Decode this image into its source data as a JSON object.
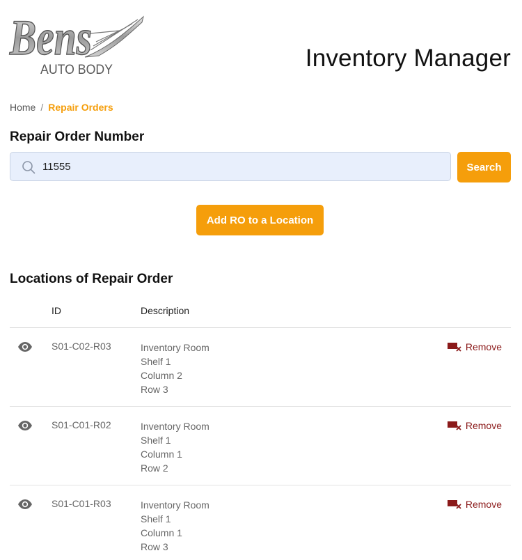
{
  "logo": {
    "brand": "Bens",
    "tagline": "AUTO BODY"
  },
  "header": {
    "title": "Inventory Manager"
  },
  "breadcrumb": {
    "home": "Home",
    "separator": "/",
    "current": "Repair Orders"
  },
  "repair_order": {
    "heading": "Repair Order Number",
    "search": {
      "value": "11555",
      "placeholder": ""
    },
    "search_button": "Search",
    "add_button": "Add RO to a Location"
  },
  "locations": {
    "heading": "Locations of Repair Order",
    "columns": {
      "id": "ID",
      "description": "Description"
    },
    "rows": [
      {
        "id": "S01-C02-R03",
        "description": [
          "Inventory Room",
          "Shelf 1",
          "Column 2",
          "Row 3"
        ],
        "action": "Remove"
      },
      {
        "id": "S01-C01-R02",
        "description": [
          "Inventory Room",
          "Shelf 1",
          "Column 1",
          "Row 2"
        ],
        "action": "Remove"
      },
      {
        "id": "S01-C01-R03",
        "description": [
          "Inventory Room",
          "Shelf 1",
          "Column 1",
          "Row 3"
        ],
        "action": "Remove"
      }
    ]
  },
  "colors": {
    "accent": "#f59e0b",
    "danger": "#8b1a1a",
    "input_bg": "#e8effc"
  },
  "icons": {
    "search": "search-icon",
    "view": "eye-icon",
    "remove": "remove-location-icon"
  }
}
